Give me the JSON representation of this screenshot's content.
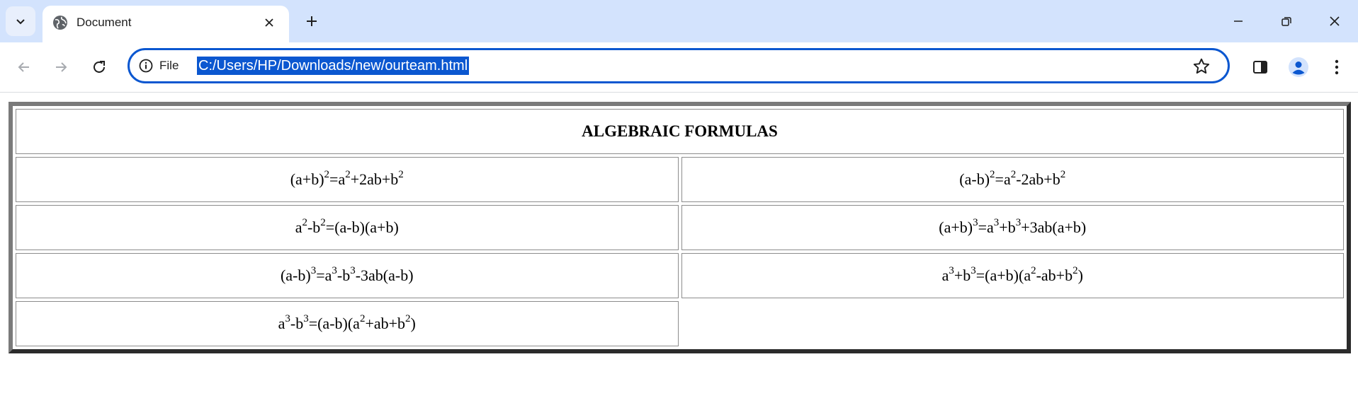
{
  "browser": {
    "tab": {
      "title": "Document"
    },
    "address": {
      "scheme_label": "File",
      "url": "C:/Users/HP/Downloads/new/ourteam.html"
    }
  },
  "page": {
    "heading": "ALGEBRAIC FORMULAS",
    "rows": [
      [
        {
          "parts": [
            [
              "t",
              "(a+b)"
            ],
            [
              "s",
              "2"
            ],
            [
              "t",
              "=a"
            ],
            [
              "s",
              "2"
            ],
            [
              "t",
              "+2ab+b"
            ],
            [
              "s",
              "2"
            ]
          ]
        },
        {
          "parts": [
            [
              "t",
              "(a-b)"
            ],
            [
              "s",
              "2"
            ],
            [
              "t",
              "=a"
            ],
            [
              "s",
              "2"
            ],
            [
              "t",
              "-2ab+b"
            ],
            [
              "s",
              "2"
            ]
          ]
        }
      ],
      [
        {
          "parts": [
            [
              "t",
              "a"
            ],
            [
              "s",
              "2"
            ],
            [
              "t",
              "-b"
            ],
            [
              "s",
              "2"
            ],
            [
              "t",
              "=(a-b)(a+b)"
            ]
          ]
        },
        {
          "parts": [
            [
              "t",
              "(a+b)"
            ],
            [
              "s",
              "3"
            ],
            [
              "t",
              "=a"
            ],
            [
              "s",
              "3"
            ],
            [
              "t",
              "+b"
            ],
            [
              "s",
              "3"
            ],
            [
              "t",
              "+3ab(a+b)"
            ]
          ]
        }
      ],
      [
        {
          "parts": [
            [
              "t",
              "(a-b)"
            ],
            [
              "s",
              "3"
            ],
            [
              "t",
              "=a"
            ],
            [
              "s",
              "3"
            ],
            [
              "t",
              "-b"
            ],
            [
              "s",
              "3"
            ],
            [
              "t",
              "-3ab(a-b)"
            ]
          ]
        },
        {
          "parts": [
            [
              "t",
              "a"
            ],
            [
              "s",
              "3"
            ],
            [
              "t",
              "+b"
            ],
            [
              "s",
              "3"
            ],
            [
              "t",
              "=(a+b)(a"
            ],
            [
              "s",
              "2"
            ],
            [
              "t",
              "-ab+b"
            ],
            [
              "s",
              "2"
            ],
            [
              "t",
              ")"
            ]
          ]
        }
      ],
      [
        {
          "parts": [
            [
              "t",
              "a"
            ],
            [
              "s",
              "3"
            ],
            [
              "t",
              "-b"
            ],
            [
              "s",
              "3"
            ],
            [
              "t",
              "=(a-b)(a"
            ],
            [
              "s",
              "2"
            ],
            [
              "t",
              "+ab+b"
            ],
            [
              "s",
              "2"
            ],
            [
              "t",
              ")"
            ]
          ]
        },
        null
      ]
    ]
  }
}
